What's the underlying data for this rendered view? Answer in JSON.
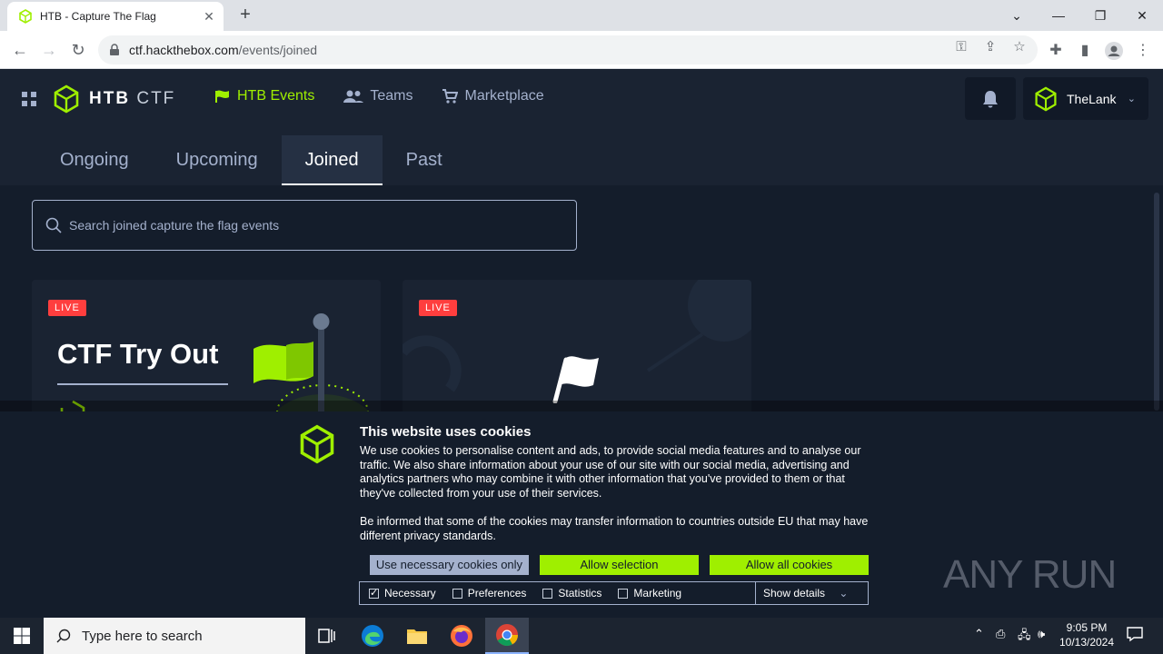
{
  "browser": {
    "tab_title": "HTB - Capture The Flag",
    "url_domain": "ctf.hackthebox.com",
    "url_path": "/events/joined"
  },
  "header": {
    "brand_bold": "HTB",
    "brand_light": " CTF",
    "nav": [
      {
        "label": "HTB Events",
        "active": true
      },
      {
        "label": "Teams",
        "active": false
      },
      {
        "label": "Marketplace",
        "active": false
      }
    ],
    "username": "TheLank"
  },
  "subtabs": [
    "Ongoing",
    "Upcoming",
    "Joined",
    "Past"
  ],
  "active_subtab": "Joined",
  "search": {
    "placeholder": "Search joined capture the flag events"
  },
  "cards": [
    {
      "badge": "LIVE",
      "title": "CTF Try Out"
    },
    {
      "badge": "LIVE",
      "title": ""
    }
  ],
  "cookie": {
    "heading": "This website uses cookies",
    "para1": "We use cookies to personalise content and ads, to provide social media features and to analyse our traffic. We also share information about your use of our site with our social media, advertising and analytics partners who may combine it with other information that you've provided to them or that they've collected from your use of their services.",
    "para2": "Be informed that some of the cookies may transfer information to countries outside EU that may have different privacy standards.",
    "btn_necessary": "Use necessary cookies only",
    "btn_selection": "Allow selection",
    "btn_all": "Allow all cookies",
    "opt_necessary": "Necessary",
    "opt_preferences": "Preferences",
    "opt_statistics": "Statistics",
    "opt_marketing": "Marketing",
    "show_details": "Show details"
  },
  "watermark": "ANY RUN",
  "taskbar": {
    "search_placeholder": "Type here to search",
    "time": "9:05 PM",
    "date": "10/13/2024"
  },
  "colors": {
    "accent": "#9fef00",
    "bg": "#141d2b",
    "panel": "#1a2332",
    "live": "#ff3e3e"
  }
}
